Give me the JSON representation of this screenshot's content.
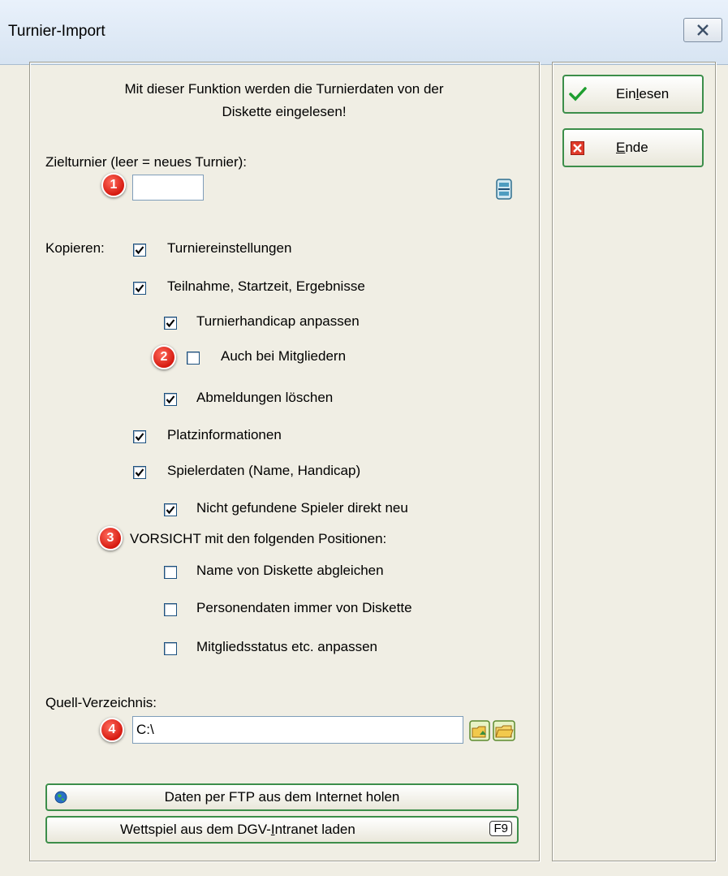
{
  "window": {
    "title": "Turnier-Import"
  },
  "intro": {
    "line1": "Mit dieser Funktion werden die Turnierdaten von der",
    "line2": "Diskette eingelesen!"
  },
  "ziel": {
    "label": "Zielturnier (leer = neues Turnier):",
    "value": ""
  },
  "kopieren": {
    "label": "Kopieren:"
  },
  "options": [
    {
      "label": "Turniereinstellungen",
      "checked": true
    },
    {
      "label": "Teilnahme, Startzeit, Ergebnisse",
      "checked": true
    },
    {
      "label": "Turnierhandicap anpassen",
      "checked": true
    },
    {
      "label": "Auch bei Mitgliedern",
      "checked": false
    },
    {
      "label": "Abmeldungen löschen",
      "checked": true
    },
    {
      "label": "Platzinformationen",
      "checked": true
    },
    {
      "label": "Spielerdaten (Name, Handicap)",
      "checked": true
    },
    {
      "label": "Nicht gefundene Spieler direkt neu",
      "checked": true
    },
    {
      "label": "Name von Diskette abgleichen",
      "checked": false
    },
    {
      "label": "Personendaten immer von Diskette",
      "checked": false
    },
    {
      "label": "Mitgliedsstatus etc. anpassen",
      "checked": false
    }
  ],
  "warning": {
    "label": "VORSICHT mit den folgenden Positionen:"
  },
  "source": {
    "label": "Quell-Verzeichnis:",
    "value": "C:\\"
  },
  "markers": [
    "1",
    "2",
    "3",
    "4"
  ],
  "buttons": {
    "ftp": "Daten per FTP aus dem Internet holen",
    "dgv_pre": "Wettspiel aus dem DGV-",
    "dgv_ul": "I",
    "dgv_post": "ntranet laden",
    "dgv_key": "F9",
    "einlesen_pre": "Ein",
    "einlesen_ul": "l",
    "einlesen_post": "esen",
    "ende_ul": "E",
    "ende_post": "nde"
  },
  "colors": {
    "accent_green": "#3c8e4a",
    "marker_red": "#d61a10"
  }
}
